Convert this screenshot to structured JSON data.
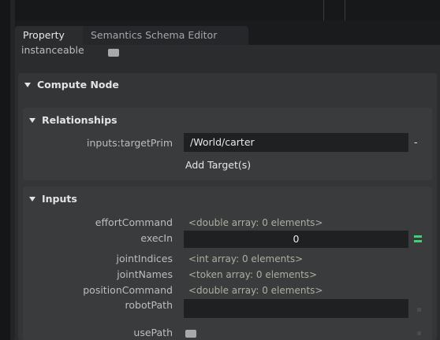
{
  "tabs": [
    {
      "label": "Property"
    },
    {
      "label": "Semantics Schema Editor"
    }
  ],
  "top_row": {
    "label": "instanceable"
  },
  "compute_node": {
    "title": "Compute Node"
  },
  "relationships": {
    "title": "Relationships",
    "target_prim_label": "inputs:targetPrim",
    "target_prim_value": "/World/carter",
    "remove_button": "-",
    "add_target_label": "Add Target(s)"
  },
  "inputs": {
    "title": "Inputs",
    "rows": [
      {
        "label": "effortCommand",
        "value": "<double array: 0 elements>"
      },
      {
        "label": "execIn",
        "value": "0"
      },
      {
        "label": "jointIndices",
        "value": "<int array: 0 elements>"
      },
      {
        "label": "jointNames",
        "value": "<token array: 0 elements>"
      },
      {
        "label": "positionCommand",
        "value": "<double array: 0 elements>"
      },
      {
        "label": "robotPath",
        "value": ""
      },
      {
        "label": "usePath",
        "value": ""
      }
    ]
  },
  "colors": {
    "accent_green": "#3fd07a",
    "panel_bg": "#2b2c2e",
    "field_bg": "#1f2021"
  }
}
